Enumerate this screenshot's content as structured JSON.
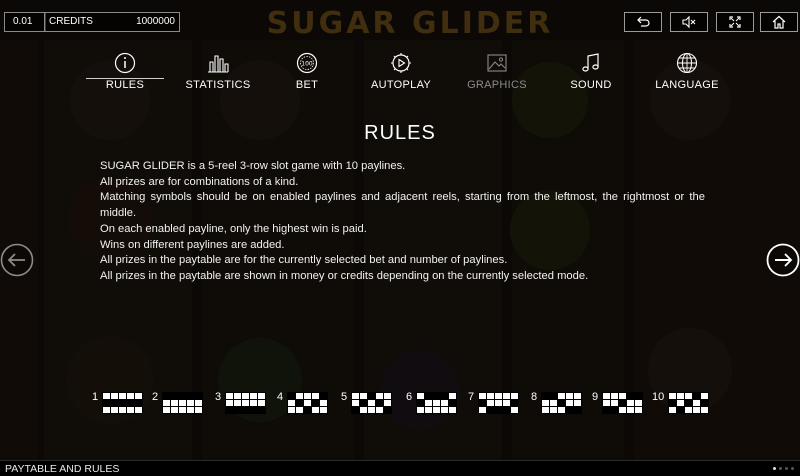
{
  "topbar": {
    "bet_value": "0.01",
    "credits_label": "CREDITS",
    "credits_value": "1000000",
    "game_title": "SUGAR GLIDER",
    "controls": [
      "back-icon",
      "mute-icon",
      "fullscreen-icon",
      "home-icon"
    ]
  },
  "tabs": [
    {
      "label": "RULES",
      "icon": "info-icon",
      "active": true
    },
    {
      "label": "STATISTICS",
      "icon": "bar-chart-icon"
    },
    {
      "label": "BET",
      "icon": "coin-icon"
    },
    {
      "label": "AUTOPLAY",
      "icon": "play-icon"
    },
    {
      "label": "GRAPHICS",
      "icon": "image-icon",
      "disabled": true
    },
    {
      "label": "SOUND",
      "icon": "music-note-icon"
    },
    {
      "label": "LANGUAGE",
      "icon": "globe-icon"
    }
  ],
  "rules": {
    "heading": "RULES",
    "lines": [
      "SUGAR GLIDER is a 5-reel 3-row slot game with 10 paylines.",
      "All prizes are for combinations of a kind.",
      "Matching symbols should be on enabled paylines and adjacent reels, starting from the leftmost, the rightmost or the middle.",
      "On each enabled payline, only the highest win is paid.",
      "Wins on different paylines are added.",
      "All prizes in the paytable are for the currently selected bet and number of paylines.",
      "All prizes in the paytable are shown in money or credits depending on the currently selected mode."
    ]
  },
  "paylines": [
    {
      "number": "1",
      "rows": [
        1,
        1,
        1,
        1,
        1
      ]
    },
    {
      "number": "2",
      "rows": [
        0,
        0,
        0,
        0,
        0
      ]
    },
    {
      "number": "3",
      "rows": [
        2,
        2,
        2,
        2,
        2
      ]
    },
    {
      "number": "4",
      "rows": [
        0,
        1,
        2,
        1,
        0
      ]
    },
    {
      "number": "5",
      "rows": [
        2,
        1,
        0,
        1,
        2
      ]
    },
    {
      "number": "6",
      "rows": [
        1,
        0,
        0,
        0,
        1
      ]
    },
    {
      "number": "7",
      "rows": [
        1,
        2,
        2,
        2,
        1
      ]
    },
    {
      "number": "8",
      "rows": [
        0,
        0,
        1,
        2,
        2
      ]
    },
    {
      "number": "9",
      "rows": [
        2,
        2,
        1,
        0,
        0
      ]
    },
    {
      "number": "10",
      "rows": [
        1,
        2,
        1,
        0,
        1
      ]
    }
  ],
  "navigation": {
    "prev": "arrow-left-icon",
    "next": "arrow-right-icon"
  },
  "bottombar": {
    "label": "PAYTABLE AND RULES",
    "pages": 4,
    "current_page": 1
  },
  "colors": {
    "background": "#0a0a0a",
    "text": "#ffffff",
    "disabled": "#8c8c8c",
    "title": "#4a3510"
  }
}
